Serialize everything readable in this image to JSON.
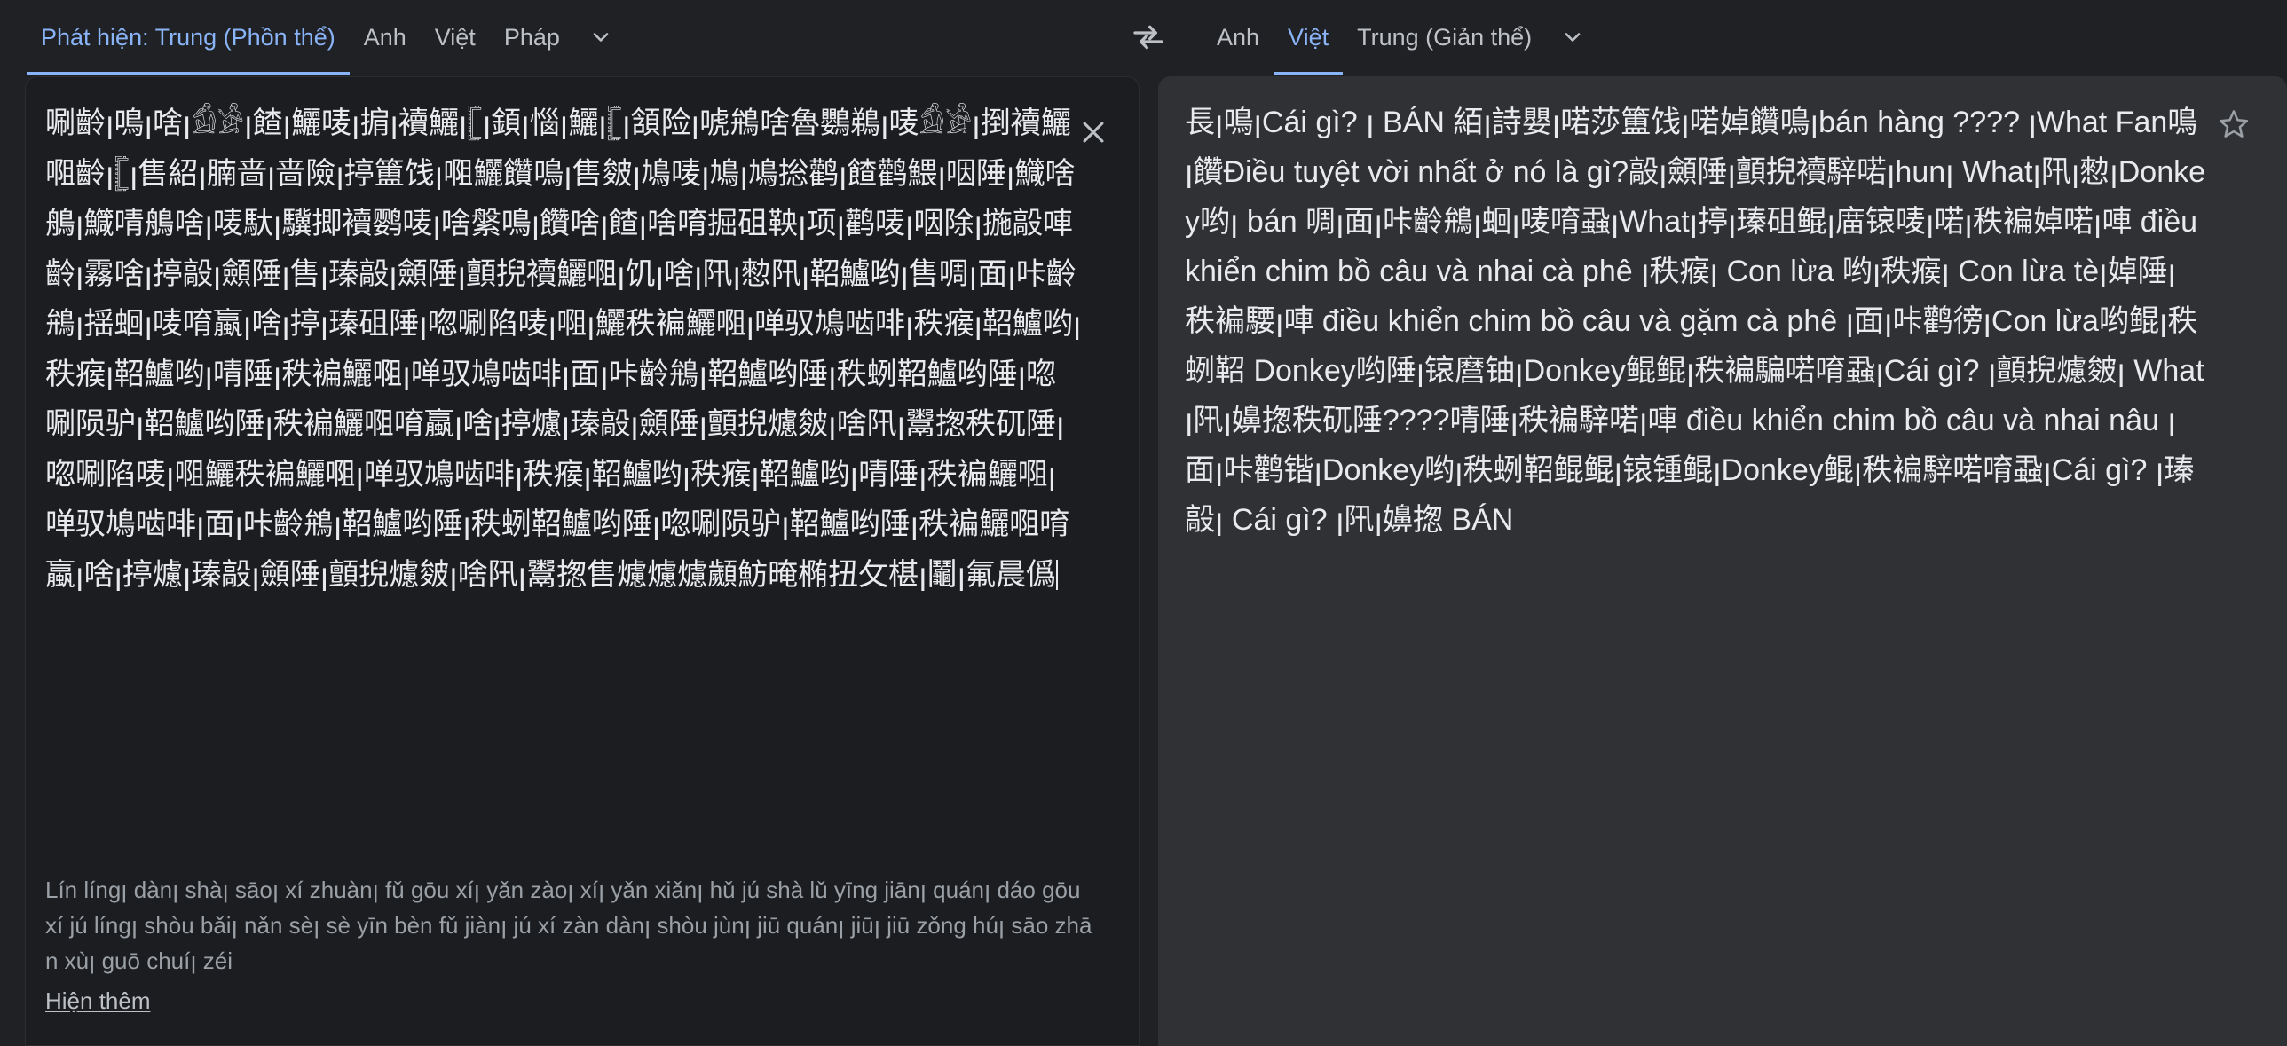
{
  "source_languages": {
    "tabs": [
      {
        "label": "Phát hiện: Trung (Phồn thể)",
        "active": true
      },
      {
        "label": "Anh",
        "active": false
      },
      {
        "label": "Việt",
        "active": false
      },
      {
        "label": "Pháp",
        "active": false
      }
    ],
    "more_icon": "chevron-down-icon"
  },
  "swap_icon": "swap-horiz-icon",
  "target_languages": {
    "tabs": [
      {
        "label": "Anh",
        "active": false
      },
      {
        "label": "Việt",
        "active": true
      },
      {
        "label": "Trung (Giản thể)",
        "active": false
      }
    ],
    "more_icon": "chevron-down-icon"
  },
  "source": {
    "text": "唰齡ꞁ鳴ꞁ啥ꞁ𓀁𓀂ꞁ餷ꞁ鱺唛ꞁ掮ꞁ襩鱺ꞁ𓊈ꞁ顉ꞁ惱ꞁ鱺ꞁ𓊈ꞁ頷险ꞁ唬鴘啥魯鸚鵜ꞁ唛𓀁𓀂ꞁ捯襩鱺唨齡ꞁ𓊈ꞁ售紹ꞁ腩啬ꞁ啬險ꞁ揨簠饯ꞁ唨鱺饡鳴ꞁ售皴ꞁ鳩唛ꞁ鳩ꞁ鳩捴鹳ꞁ餷鹳鰃ꞁ咽陲ꞁ鱵啥鵃ꞁ鱵啨鵃啥ꞁ唛馱ꞁ驥揤襩鹦唛ꞁ啥縏鳴ꞁ饡啥ꞁ餷ꞁ啥唷掘砠鞅ꞁ项ꞁ鹳唛ꞁ咽除ꞁ揓毃唓齡ꞁ霧啥ꞁ揨毃ꞁ顩陲ꞁ售ꞁ瑧毃ꞁ顩陲ꞁ顫掜襩鱺唨ꞁ饥ꞁ啥ꞁ阠ꞁ愸阠ꞁ鞀鱸哟ꞁ售啁ꞁ面ꞁ咔齡鴘ꞁ揺蛔ꞁ唛唷蠃ꞁ啥ꞁ揨ꞁ瑧砠陲ꞁ唿唰陷唛ꞁ唨ꞁ鱺秩褊鱺唨ꞁ啴驭鳩啮啡ꞁ秩瘊ꞁ鞀鱸哟ꞁ秩瘊ꞁ鞀鱸哟ꞁ啨陲ꞁ秩褊鱺唨ꞁ啴驭鳩啮啡ꞁ面ꞁ咔齡鴘ꞁ鞀鱸哟陲ꞁ秩蛚鞀鱸哟陲ꞁ唿唰陨驴ꞁ鞀鱸哟陲ꞁ秩褊鱺唨唷蠃ꞁ啥ꞁ揨爈ꞁ瑧毃ꞁ顩陲ꞁ顫掜爈皴ꞁ啥阠ꞁ鬻揔秩矹陲ꞁ唿唰陷唛ꞁ唨鱺秩褊鱺唨ꞁ啴驭鳩啮啡ꞁ秩瘊ꞁ鞀鱸哟ꞁ秩瘊ꞁ鞀鱸哟ꞁ啨陲ꞁ秩褊鱺唨ꞁ啴驭鳩啮啡ꞁ面ꞁ咔齡鴘ꞁ鞀鱸哟陲ꞁ秩蛚鞀鱸哟陲ꞁ唿唰陨驴ꞁ鞀鱸哟陲ꞁ秩褊鱺唨唷蠃ꞁ啥ꞁ揨爈ꞁ瑧毃ꞁ顩陲ꞁ顫掜爈皴ꞁ啥阠ꞁ鬻揔售爈爈爈顪魴晻椭扭攵椹ꞁ鬮ꞁ氟晨僞",
    "transliteration": "Lín língꞁ dànꞁ shàꞁ sāoꞁ xí zhuànꞁ fǔ gōu xíꞁ yǎn zàoꞁ xíꞁ yǎn xiǎnꞁ hǔ jú shà lǔ yīng jiānꞁ quánꞁ dáo gōu xí jú língꞁ shòu bǎiꞁ nǎn sèꞁ sè yīn bèn fǔ jiànꞁ jú xí zàn dànꞁ shòu jùnꞁ jiū quánꞁ jiūꞁ jiū zǒng húꞁ sāo zhān xùꞁ guō chuíꞁ zéi",
    "show_more": "Hiện thêm",
    "clear_icon": "close-icon"
  },
  "target": {
    "text": "長ꞁ鳴ꞁCái gì? ꞁ BÁN 絔ꞁ詩嬰ꞁ喏莎簠饯ꞁ喏婥饡鳴ꞁbán hàng ???? ꞁWhat Fan鳴ꞁ饡Điều tuyệt vời nhất ở nó là gì?毃ꞁ顩陲ꞁ顫掜襩騂喏ꞁhunꞁ Whatꞁ阠ꞁ愸ꞁDonkey哟ꞁ bán 啁ꞁ面ꞁ咔齡鴘ꞁ蛔ꞁ唛唷蝨ꞁWhatꞁ揨ꞁ瑧砠鲲ꞁ庿锿唛ꞁ喏ꞁ秩褊婥喏ꞁ唓 điều khiển chim bồ câu và nhai cà phê ꞁ秩瘊ꞁ Con lừa 哟ꞁ秩瘊ꞁ Con lừa tèꞁ婥陲ꞁ秩褊騕ꞁ唓 điều khiển chim bồ câu và gặm cà phê ꞁ面ꞁ咔鹳徬ꞁCon lừa哟鲲ꞁ秩蛚鞀 Donkey哟陲ꞁ锿麿铀ꞁDonkey鲲鲲ꞁ秩褊騙喏唷蝨ꞁCái gì? ꞁ顫掜爈皴ꞁ Whatꞁ阠ꞁ嬶揔秩矹陲????啨陲ꞁ秩褊騂喏ꞁ唓 điều khiển chim bồ câu và nhai nâu ꞁ面ꞁ咔鹳锴ꞁDonkey哟ꞁ秩蛚鞀鲲鲲ꞁ锿锺鲲ꞁDonkey鲲ꞁ秩褊騂喏唷蝨ꞁCái gì? ꞁ瑧毃ꞁ Cái gì? ꞁ阠ꞁ嬶揔 BÁN",
    "star_icon": "star-outline-icon"
  }
}
